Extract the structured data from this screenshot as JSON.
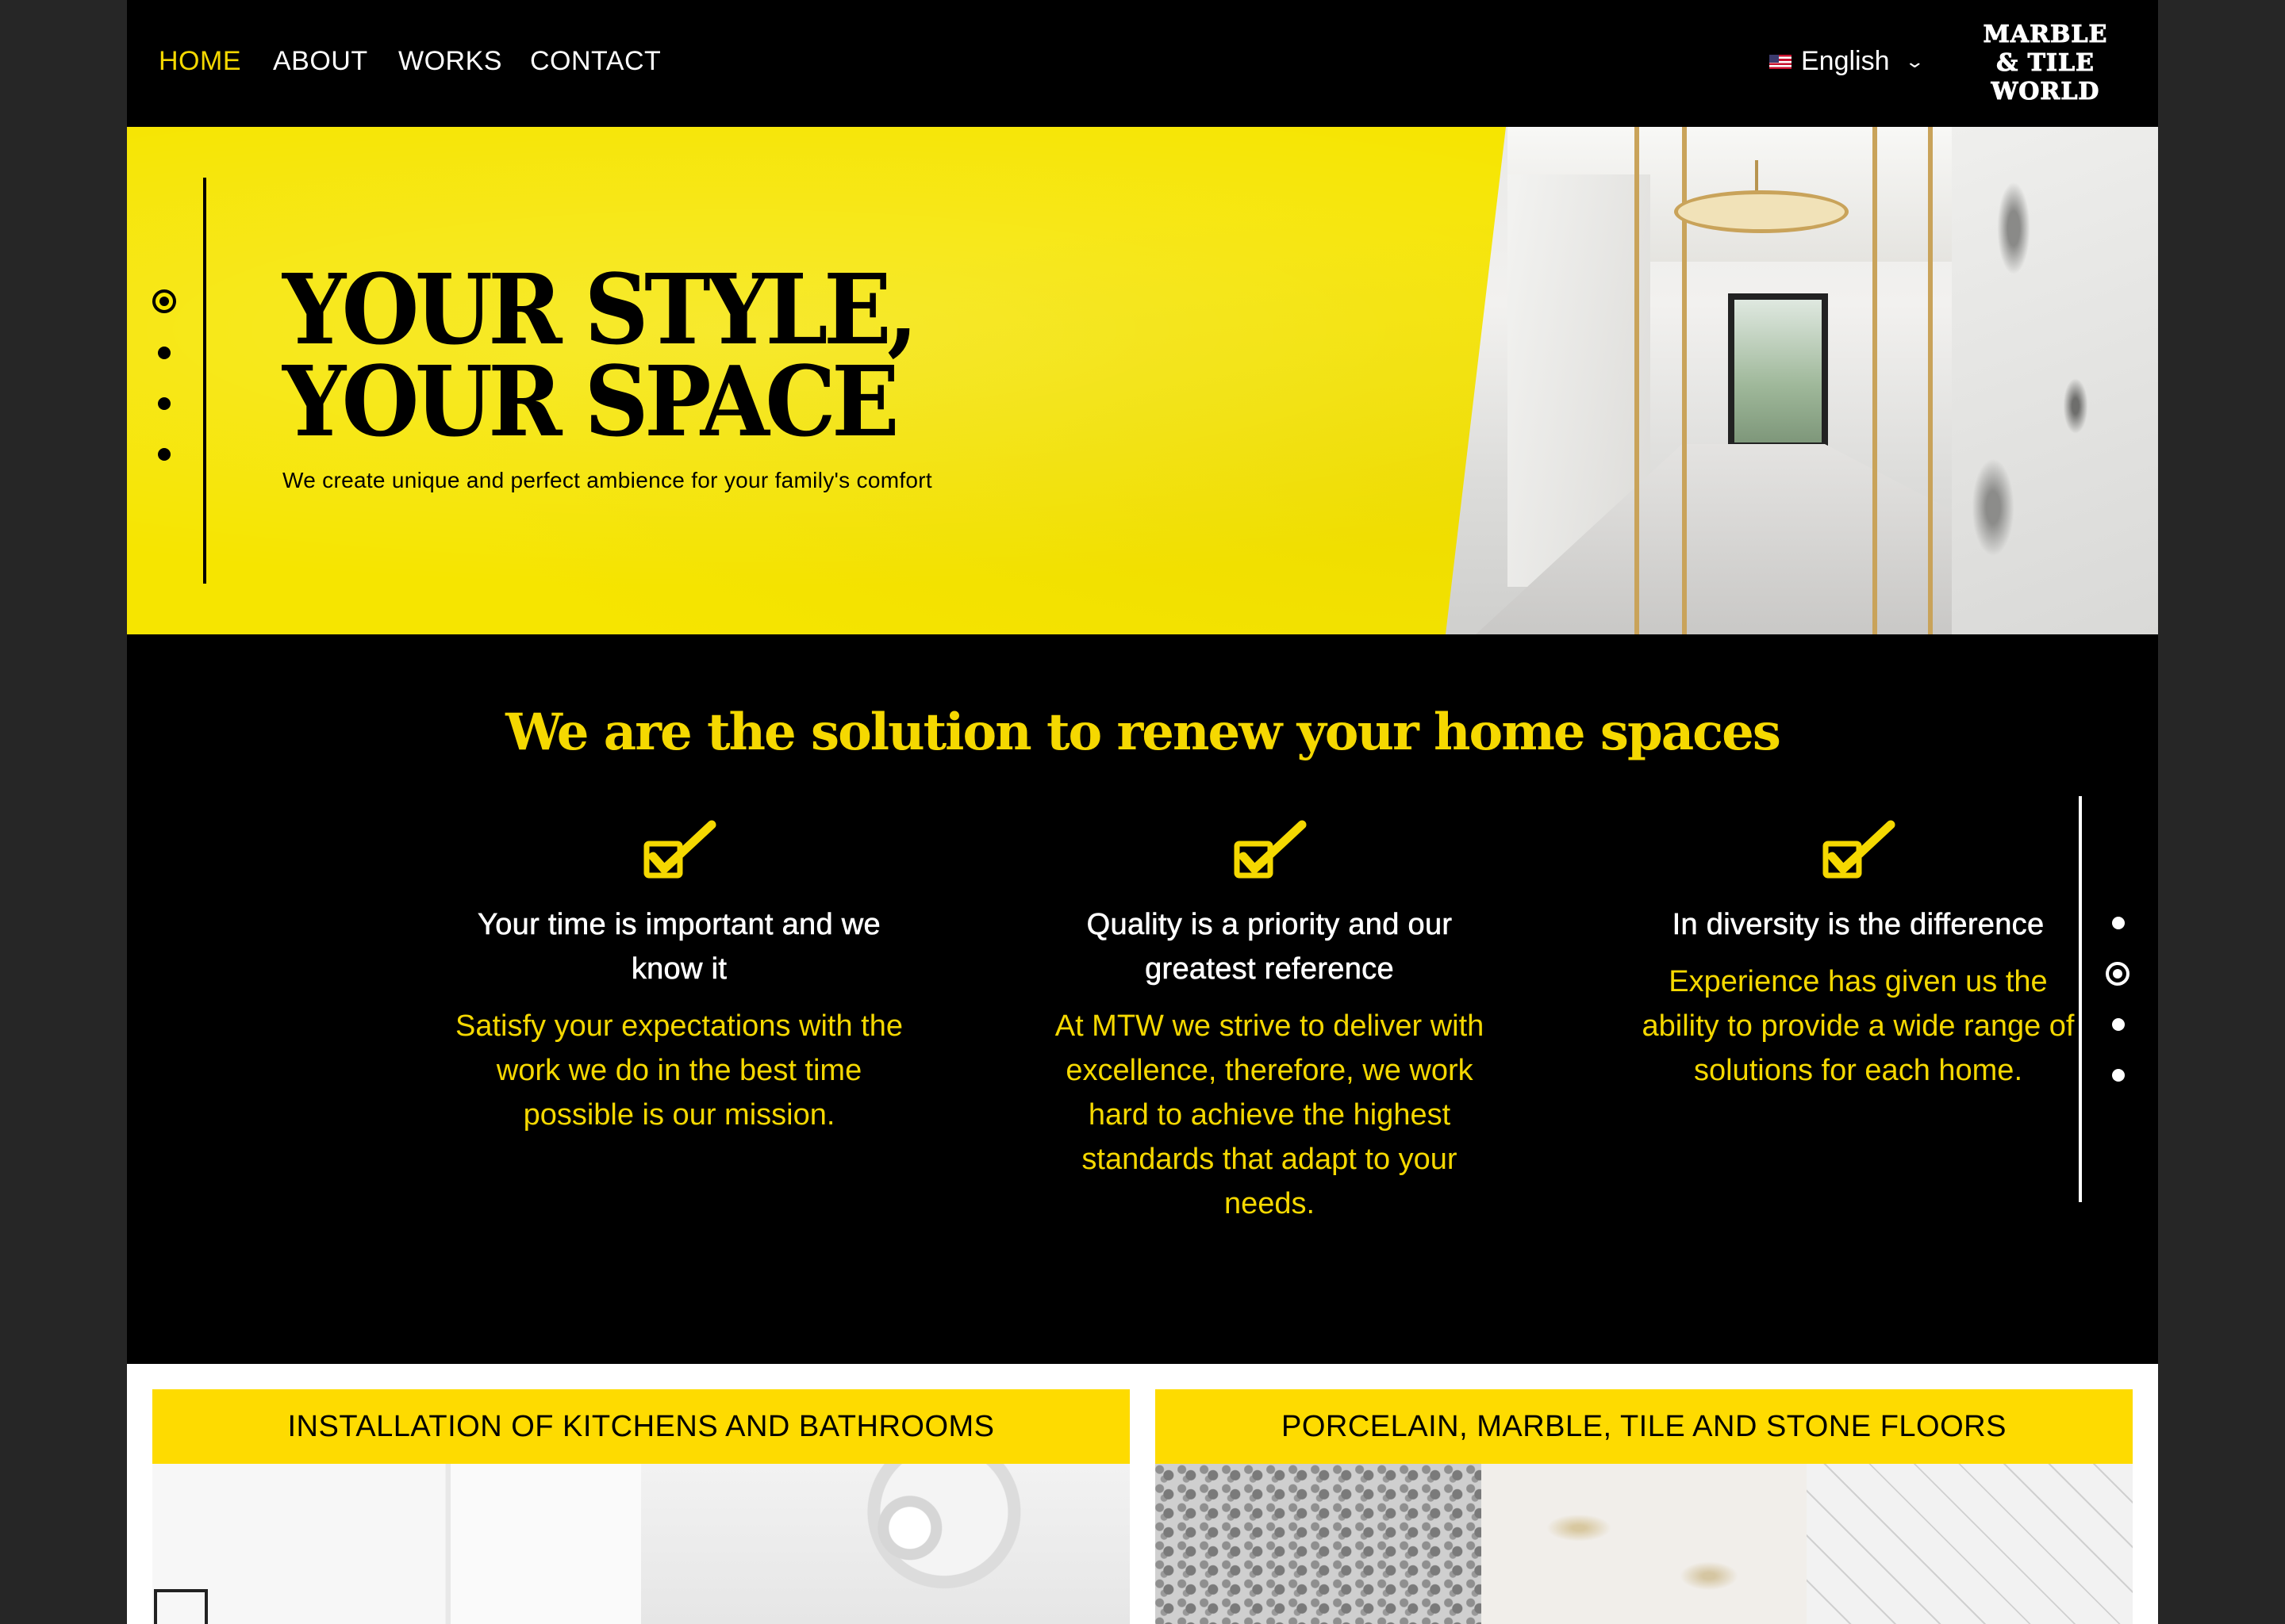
{
  "nav": {
    "items": [
      {
        "label": "HOME",
        "active": true
      },
      {
        "label": "ABOUT",
        "active": false
      },
      {
        "label": "WORKS",
        "active": false
      },
      {
        "label": "CONTACT",
        "active": false
      }
    ],
    "language": {
      "label": "English",
      "flag_icon": "us-flag-icon",
      "chevron_icon": "chevron-down-icon"
    },
    "logo": {
      "line1": "MARBLE",
      "line2": "& TILE",
      "line3": "WORLD"
    }
  },
  "hero": {
    "title_line1": "YOUR STYLE,",
    "title_line2": "YOUR SPACE",
    "subtitle": "We create unique and perfect ambience for your family's comfort",
    "slides_count": 4,
    "active_slide": 1
  },
  "features": {
    "title": "We are the solution to renew your home spaces",
    "items": [
      {
        "heading_line1": "Your time is important and we",
        "heading_line2": "know it",
        "text_line1": "Satisfy your expectations with the",
        "text_line2": "work we do in the best time",
        "text_line3": "possible is our mission.",
        "text_line4": "",
        "text_line5": ""
      },
      {
        "heading_line1": "Quality is a priority and our",
        "heading_line2": "greatest reference",
        "text_line1": "At MTW we strive to deliver with",
        "text_line2": "excellence, therefore, we work",
        "text_line3": "hard to achieve the highest",
        "text_line4": "standards that adapt to your",
        "text_line5": "needs."
      },
      {
        "heading_line1": "In diversity is the difference",
        "heading_line2": "",
        "text_line1": "Experience has given us the",
        "text_line2": "ability to provide a wide range of",
        "text_line3": "solutions for each home.",
        "text_line4": "",
        "text_line5": ""
      }
    ],
    "slides_count": 4,
    "active_slide": 2
  },
  "services": [
    {
      "title": "INSTALLATION OF KITCHENS AND BATHROOMS"
    },
    {
      "title": "PORCELAIN, MARBLE, TILE AND STONE FLOORS"
    }
  ],
  "colors": {
    "accent": "#f5d800",
    "hero_yellow": "#f6e500",
    "background": "#000000",
    "service_bar": "#fedb00"
  }
}
